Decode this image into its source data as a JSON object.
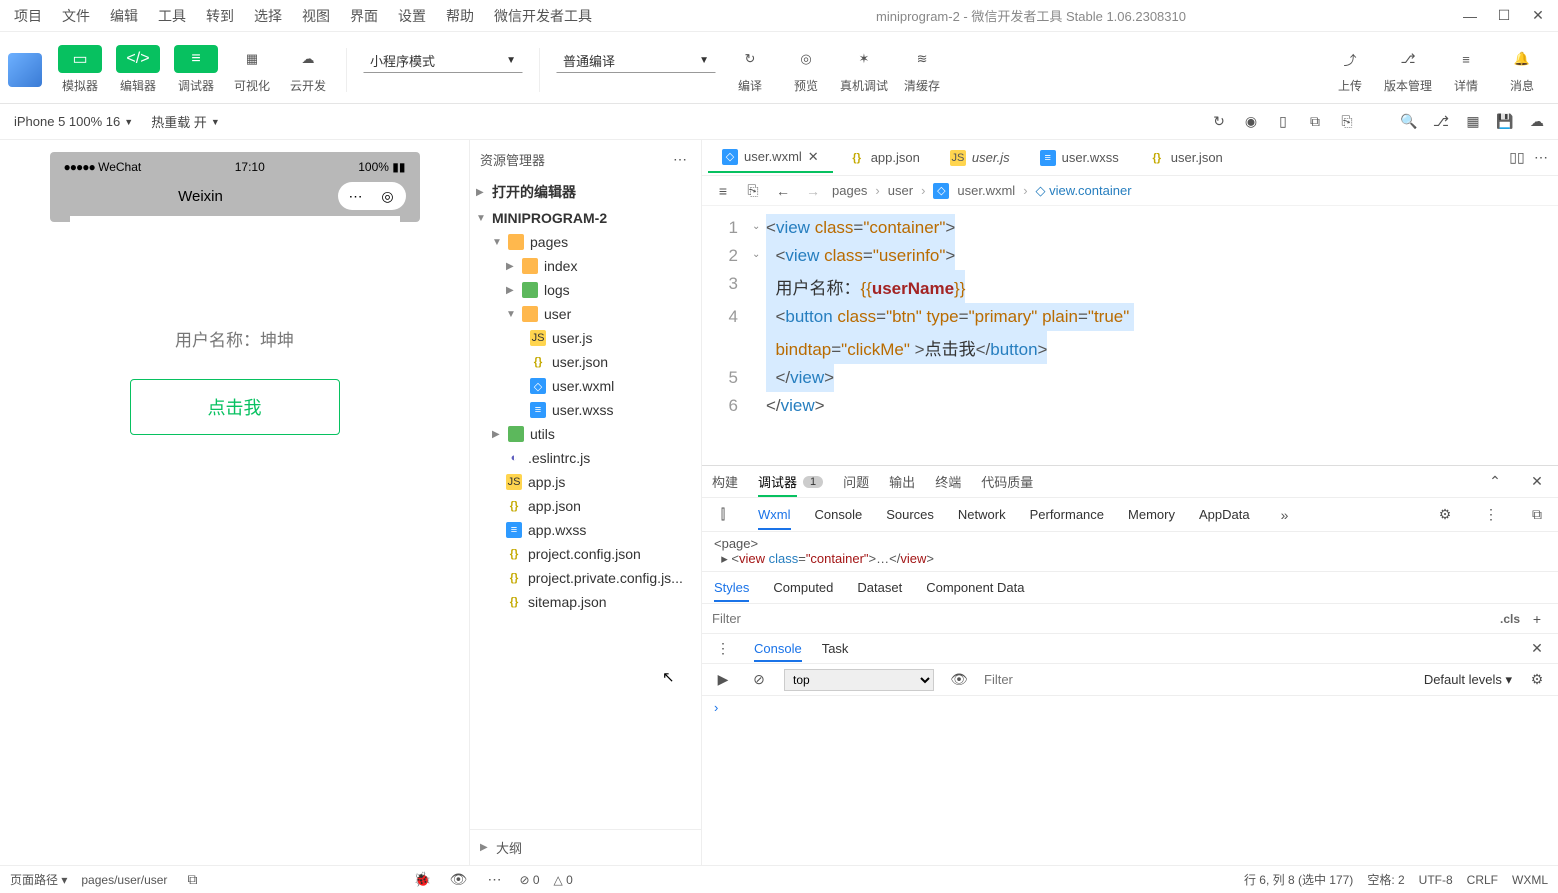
{
  "window_title": "miniprogram-2 - 微信开发者工具 Stable 1.06.2308310",
  "menu": [
    "项目",
    "文件",
    "编辑",
    "工具",
    "转到",
    "选择",
    "视图",
    "界面",
    "设置",
    "帮助",
    "微信开发者工具"
  ],
  "toolbar": {
    "simulator": "模拟器",
    "editor": "编辑器",
    "debugger": "调试器",
    "visualize": "可视化",
    "cloud": "云开发",
    "mode": "小程序模式",
    "compile_profile": "普通编译",
    "compile": "编译",
    "preview": "预览",
    "realdevice": "真机调试",
    "clearcache": "清缓存",
    "upload": "上传",
    "version": "版本管理",
    "details": "详情",
    "messages": "消息"
  },
  "topstrip": {
    "device": "iPhone 5 100% 16",
    "hotreload": "热重载 开"
  },
  "preview": {
    "carrier": "WeChat",
    "time": "17:10",
    "battery": "100%",
    "appname": "Weixin",
    "username_label": "用户名称：坤坤",
    "button": "点击我"
  },
  "explorer": {
    "title": "资源管理器",
    "open_editors": "打开的编辑器",
    "project": "MINIPROGRAM-2",
    "pages": "pages",
    "index": "index",
    "logs": "logs",
    "user_dir": "user",
    "userjs": "user.js",
    "userjson": "user.json",
    "userwxml": "user.wxml",
    "userwxss": "user.wxss",
    "utils": "utils",
    "eslintrc": ".eslintrc.js",
    "appjs": "app.js",
    "appjson": "app.json",
    "appwxss": "app.wxss",
    "pconfig": "project.config.json",
    "pprivate": "project.private.config.js...",
    "sitemap": "sitemap.json",
    "outline": "大纲"
  },
  "tabs": {
    "t1": "user.wxml",
    "t2": "app.json",
    "t3": "user.js",
    "t4": "user.wxss",
    "t5": "user.json"
  },
  "crumb": {
    "p1": "pages",
    "p2": "user",
    "p3": "user.wxml",
    "p4": "view.container"
  },
  "code": {
    "l3_text": "  用户名称：",
    "l3_var": "userName",
    "l4_btn": "点击我",
    "l4_bindtap": "clickMe"
  },
  "devtools": {
    "build": "构建",
    "debugger": "调试器",
    "badge": "1",
    "issues": "问题",
    "output": "输出",
    "terminal": "终端",
    "quality": "代码质量",
    "wxml": "Wxml",
    "console": "Console",
    "sources": "Sources",
    "network": "Network",
    "performance": "Performance",
    "memory": "Memory",
    "appdata": "AppData",
    "page_tag": "<page>",
    "styles": "Styles",
    "computed": "Computed",
    "dataset": "Dataset",
    "componentdata": "Component Data",
    "filter_ph": "Filter",
    "cls": ".cls",
    "ctab_console": "Console",
    "ctab_task": "Task",
    "top": "top",
    "filter2_ph": "Filter",
    "levels": "Default levels"
  },
  "status": {
    "path_label": "页面路径",
    "path": "pages/user/user",
    "err": "0",
    "warn": "0",
    "pos": "行 6, 列 8 (选中 177)",
    "spaces": "空格: 2",
    "enc": "UTF-8",
    "eol": "CRLF",
    "lang": "WXML"
  }
}
